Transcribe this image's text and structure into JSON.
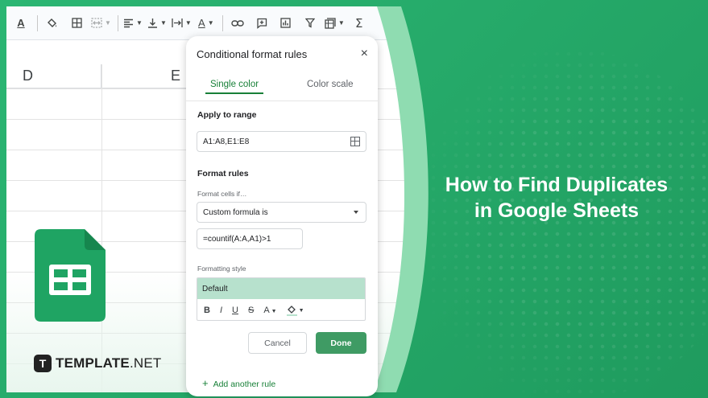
{
  "headline": {
    "line1": "How to Find Duplicates",
    "line2": "in Google Sheets"
  },
  "brand": {
    "mark": "T",
    "name_bold": "TEMPLATE",
    "name_thin": ".NET"
  },
  "toolbar": {
    "icons": [
      "text-color-icon",
      "fill-color-icon",
      "borders-icon",
      "merge-cells-icon",
      "horizontal-align-icon",
      "vertical-align-icon",
      "text-wrap-icon",
      "text-rotation-icon",
      "insert-link-icon",
      "insert-comment-icon",
      "insert-chart-icon",
      "filter-icon",
      "filter-views-icon",
      "functions-icon"
    ]
  },
  "sheet": {
    "columns": [
      "D",
      "E"
    ]
  },
  "dialog": {
    "title": "Conditional format rules",
    "close_label": "×",
    "tabs": [
      {
        "label": "Single color",
        "active": true
      },
      {
        "label": "Color scale",
        "active": false
      }
    ],
    "apply_to_range_label": "Apply to range",
    "range_value": "A1:A8,E1:E8",
    "format_rules_label": "Format rules",
    "format_cells_if_label": "Format cells if…",
    "condition_value": "Custom formula is",
    "formula_value": "=countif(A:A,A1)>1",
    "formatting_style_label": "Formatting style",
    "style_preview_text": "Default",
    "style_preview_color": "#b7e1cd",
    "style_tools": [
      "B",
      "I",
      "U",
      "S",
      "A"
    ],
    "cancel_label": "Cancel",
    "done_label": "Done",
    "add_rule_label": "Add another rule",
    "accent_color": "#188038"
  },
  "colors": {
    "background": "#23a566",
    "done_button": "#3f9b64",
    "sheets_logo": "#1fa463"
  }
}
